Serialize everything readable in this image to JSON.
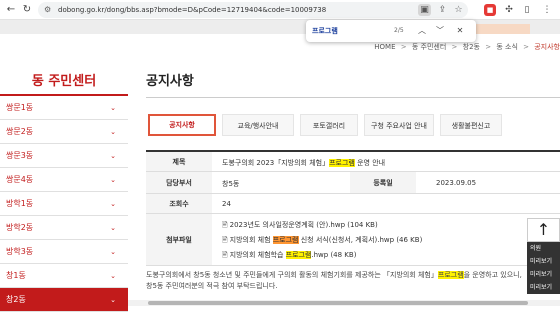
{
  "browser": {
    "url": "dobong.go.kr/dong/bbs.asp?bmode=D&pCode=12719404&code=10009738",
    "find": {
      "query": "프로그램",
      "count": "2/5"
    }
  },
  "breadcrumb": {
    "home": "HOME",
    "items": [
      "동 주민센터",
      "창2동",
      "동 소식",
      "공지사항"
    ]
  },
  "sidebar": {
    "title": "동 주민센터",
    "items": [
      {
        "label": "쌍문1동"
      },
      {
        "label": "쌍문2동"
      },
      {
        "label": "쌍문3동"
      },
      {
        "label": "쌍문4동"
      },
      {
        "label": "방학1동"
      },
      {
        "label": "방학2동"
      },
      {
        "label": "방학3동"
      },
      {
        "label": "창1동"
      },
      {
        "label": "창2동"
      }
    ]
  },
  "main": {
    "title": "공지사항",
    "tabs": [
      "공지사항",
      "교육/행사안내",
      "포토갤러리",
      "구청 주요사업 안내",
      "생활불편신고"
    ]
  },
  "post": {
    "subject_label": "제목",
    "subject_prefix": "도봉구의회 2023「지방의회 체험」",
    "subject_hl": "프로그램",
    "subject_suffix": " 운영 안내",
    "dept_label": "담당부서",
    "dept_value": "창5동",
    "date_label": "등록일",
    "date_value": "2023.09.05",
    "views_label": "조회수",
    "views_value": "24",
    "files_label": "첨부파일",
    "file1": "2023년도 의사일정운영계획 (안).hwp (104 KB)",
    "file2_prefix": "지방의회 체험 ",
    "file2_hl": "프로그램",
    "file2_suffix": " 신청 서식(신청서, 계획서).hwp (46 KB)",
    "file3_prefix": "지방의회 체험학습 ",
    "file3_hl": "프로그램",
    "file3_suffix": ".hwp (48 KB)",
    "body_line1_prefix": "도봉구의회에서 창5동 청소년 및 주민들에게 구의회 활동의 체험기회를 제공하는 「지방의회 체험」",
    "body_line1_hl": "프로그램",
    "body_line1_suffix": "을 운영하고 있으니,",
    "body_line2": "창5동 주민여러분의 적극 참여 부탁드립니다."
  },
  "quick_panel": {
    "items": [
      "의원",
      "미리보기",
      "미리보기",
      "미리보기"
    ]
  }
}
